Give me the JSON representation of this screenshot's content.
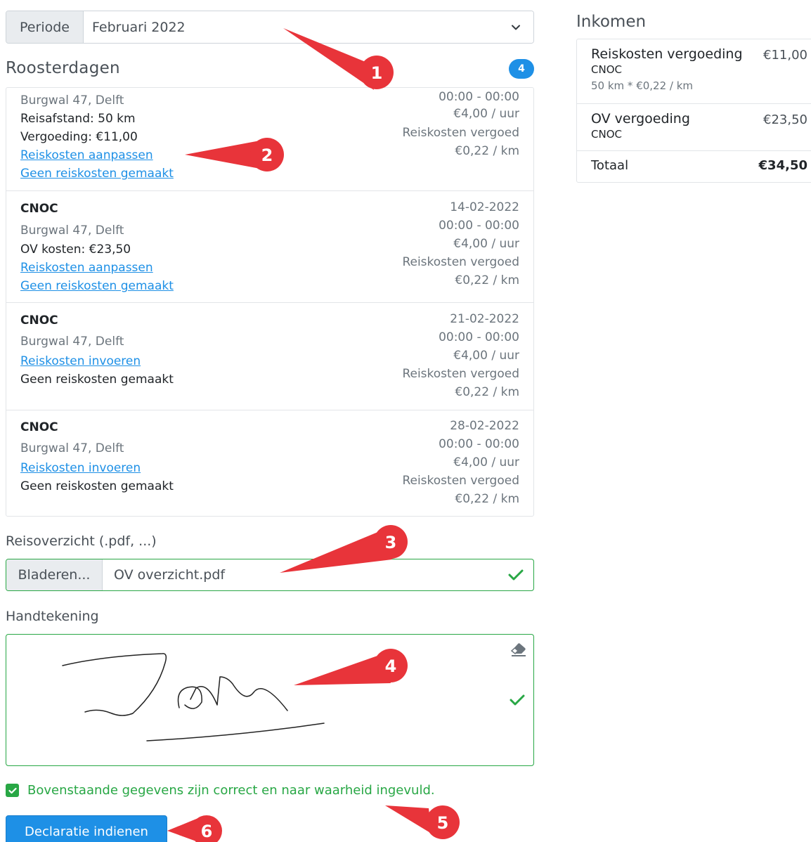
{
  "period": {
    "label": "Periode",
    "value": "Februari 2022"
  },
  "rooster": {
    "title": "Roosterdagen",
    "count": "4",
    "items": [
      {
        "address": "Burgwal 47, Delft",
        "line1": "Reisafstand: 50 km",
        "line2": "Vergoeding: €11,00",
        "link1": "Reiskosten aanpassen",
        "link2": "Geen reiskosten gemaakt",
        "time": "00:00 - 00:00",
        "rate": "€4,00 / uur",
        "status": "Reiskosten vergoed",
        "km_rate": "€0,22 / km"
      },
      {
        "company": "CNOC",
        "address": "Burgwal 47, Delft",
        "line1": "OV kosten: €23,50",
        "link1": "Reiskosten aanpassen",
        "link2": "Geen reiskosten gemaakt",
        "date": "14-02-2022",
        "time": "00:00 - 00:00",
        "rate": "€4,00 / uur",
        "status": "Reiskosten vergoed",
        "km_rate": "€0,22 / km"
      },
      {
        "company": "CNOC",
        "address": "Burgwal 47, Delft",
        "link1": "Reiskosten invoeren",
        "note": "Geen reiskosten gemaakt",
        "date": "21-02-2022",
        "time": "00:00 - 00:00",
        "rate": "€4,00 / uur",
        "status": "Reiskosten vergoed",
        "km_rate": "€0,22 / km"
      },
      {
        "company": "CNOC",
        "address": "Burgwal 47, Delft",
        "link1": "Reiskosten invoeren",
        "note": "Geen reiskosten gemaakt",
        "date": "28-02-2022",
        "time": "00:00 - 00:00",
        "rate": "€4,00 / uur",
        "status": "Reiskosten vergoed",
        "km_rate": "€0,22 / km"
      }
    ]
  },
  "upload": {
    "label": "Reisoverzicht (.pdf, ...)",
    "button": "Bladeren...",
    "filename": "OV overzicht.pdf"
  },
  "signature": {
    "label": "Handtekening"
  },
  "agreement": {
    "text": "Bovenstaande gegevens zijn correct en naar waarheid ingevuld."
  },
  "submit": {
    "label": "Declaratie indienen"
  },
  "income": {
    "title": "Inkomen",
    "rows": [
      {
        "title": "Reiskosten vergoeding",
        "company": "CNOC",
        "detail": "50 km * €0,22 / km",
        "amount": "€11,00"
      },
      {
        "title": "OV vergoeding",
        "company": "CNOC",
        "amount": "€23,50"
      }
    ],
    "total_label": "Totaal",
    "total_amount": "€34,50"
  },
  "callouts": [
    "1",
    "2",
    "3",
    "4",
    "5",
    "6"
  ],
  "colors": {
    "accent": "#1e90e6",
    "success": "#28a745",
    "callout": "#e8343a"
  },
  "icons": [
    "chevron-down-icon",
    "check-icon",
    "eraser-icon",
    "checkbox-checked-icon"
  ]
}
